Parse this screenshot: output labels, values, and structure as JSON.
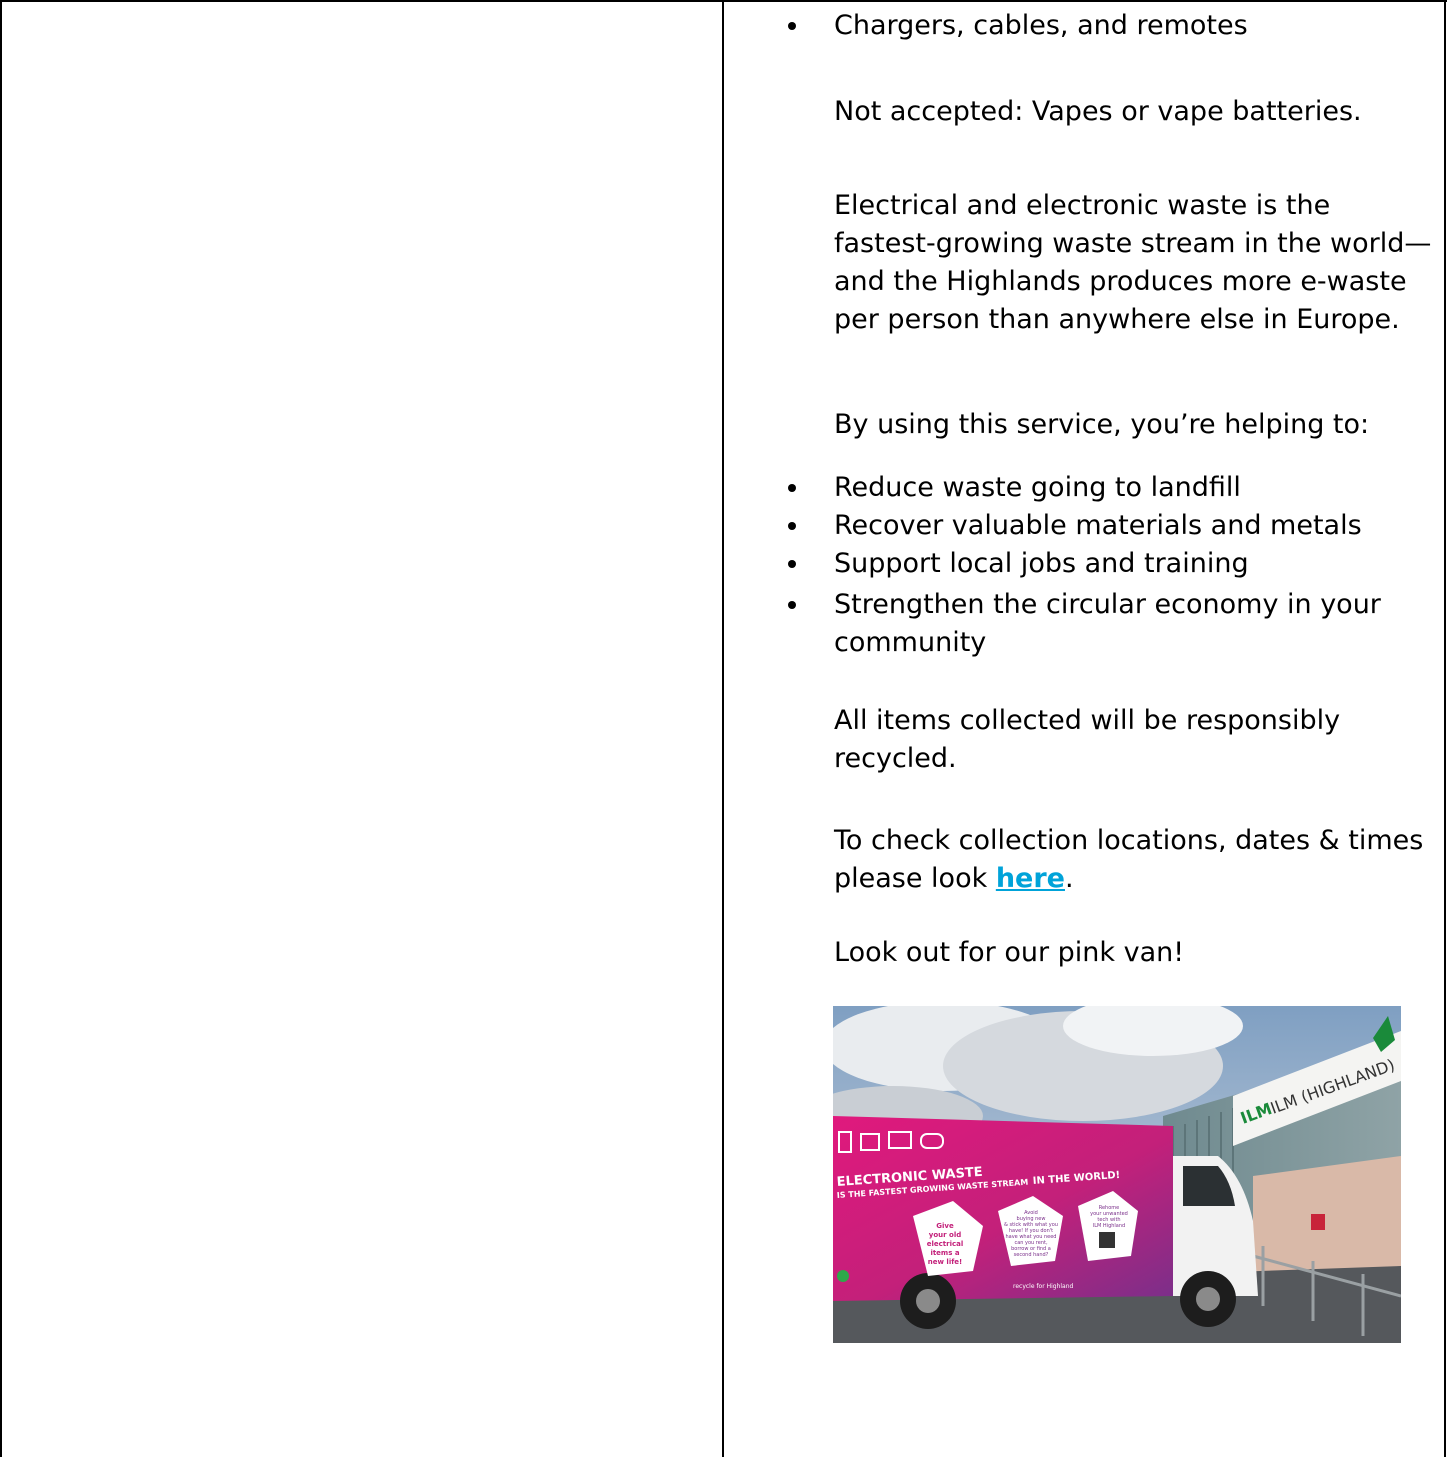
{
  "right_column": {
    "bullets_top": [
      "Chargers, cables, and remotes"
    ],
    "not_accepted": "Not accepted: Vapes or vape batteries.",
    "para_waste": "Electrical and electronic waste is the fastest-growing waste stream in the world—and the Highlands produces more e-waste per person than anywhere else in Europe.",
    "para_helping": "By using this service, you’re helping to:",
    "bullets_benefits": [
      "Reduce waste going to landfill",
      "Recover valuable materials and metals",
      "Support local jobs and training",
      "Strengthen the circular economy in your community"
    ],
    "para_recycled": "All items collected will be responsibly recycled.",
    "para_check_prefix": "To check collection locations, dates & times please look ",
    "para_check_link": "here",
    "para_check_suffix": ".",
    "para_van": "Look out for our pink van!",
    "photo": {
      "sign_text": "ILM (HIGHLAND)",
      "sign_logo_text": "ILM",
      "van_headline_1": "ELECTRONIC WASTE",
      "van_headline_2": "IS THE FASTEST GROWING WASTE STREAM",
      "van_headline_3": "IN THE WORLD!",
      "pentagon_1": [
        "Give",
        "your old",
        "electrical",
        "items a",
        "new life!"
      ],
      "pentagon_2": [
        "Avoid",
        "buying new",
        "& stick with what you",
        "have! If you don't",
        "have what you need",
        "can you rent,",
        "borrow or find a",
        "second hand?"
      ],
      "pentagon_3": [
        "Rehome",
        "your unwanted",
        "tech with",
        "ILM Highland"
      ],
      "van_footer": "recycle for Highland"
    }
  }
}
